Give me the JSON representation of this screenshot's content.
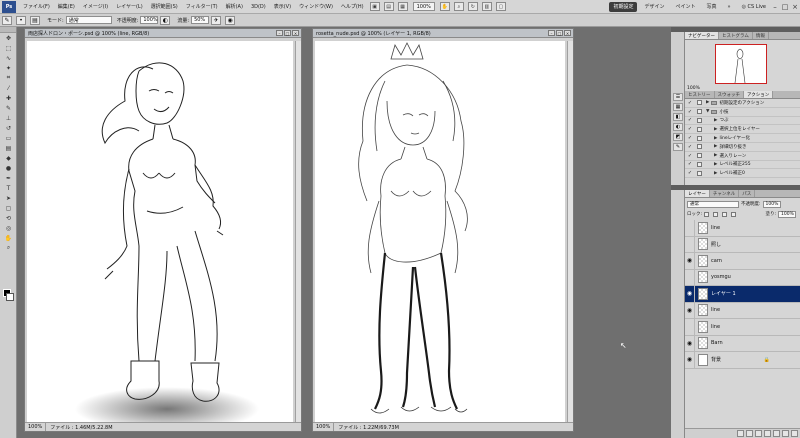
{
  "menubar": {
    "app_logo": "Ps",
    "items": [
      "ファイル(F)",
      "編集(E)",
      "イメージ(I)",
      "レイヤー(L)",
      "選択範囲(S)",
      "フィルター(T)",
      "解析(A)",
      "3D(D)",
      "表示(V)",
      "ウィンドウ(W)",
      "ヘルプ(H)"
    ],
    "zoom": "100%",
    "workspaces": [
      "初期設定",
      "デザイン",
      "ペイント",
      "写真"
    ],
    "active_workspace": "初期設定",
    "more": "»",
    "cslive": "CS Live",
    "window_controls": [
      "–",
      "□",
      "×"
    ]
  },
  "options": {
    "mode_label": "モード:",
    "mode_value": "通常",
    "opacity_label": "不透明度:",
    "opacity_value": "100%",
    "flow_label": "流量:",
    "flow_value": "50%"
  },
  "tools": {
    "icons": [
      "move-icon",
      "marquee-icon",
      "lasso-icon",
      "quick-select-icon",
      "crop-icon",
      "eyedropper-icon",
      "heal-icon",
      "brush-icon",
      "stamp-icon",
      "history-brush-icon",
      "eraser-icon",
      "gradient-icon",
      "blur-icon",
      "dodge-icon",
      "pen-icon",
      "type-icon",
      "path-select-icon",
      "shape-icon",
      "3d-rotate-icon",
      "3d-orbit-icon",
      "hand-icon",
      "zoom-icon"
    ],
    "foreground_color": "#000000",
    "background_color": "#ffffff"
  },
  "doc1": {
    "title": "両店探人ドロン・ポーシ.psd @ 100% (line, RGB/8)",
    "zoom": "100%",
    "file_size": "ファイル : 1.46M/5.22.8M"
  },
  "doc2": {
    "title": "rosetta_nude.psd @ 100% (レイヤー 1, RGB/8)",
    "zoom": "100%",
    "file_size": "ファイル : 1.22M/69.73M"
  },
  "navigator": {
    "tabs": [
      "ナビゲーター",
      "ヒストグラム",
      "情報"
    ],
    "zoom": "100%"
  },
  "actions": {
    "tabs": [
      "ヒストリー",
      "スウォッチ",
      "アクション"
    ],
    "rows": [
      {
        "label": "初期設定のアクション",
        "kind": "set"
      },
      {
        "label": "小技",
        "kind": "set"
      },
      {
        "label": "つぶ",
        "kind": "action"
      },
      {
        "label": "選択上位をレイヤー",
        "kind": "action"
      },
      {
        "label": "lineレイヤー化",
        "kind": "action"
      },
      {
        "label": "詳細切り抜き",
        "kind": "action"
      },
      {
        "label": "選入りレーン",
        "kind": "action"
      },
      {
        "label": "レベル補正255",
        "kind": "action"
      },
      {
        "label": "レベル補正0",
        "kind": "action"
      }
    ]
  },
  "layers": {
    "tabs": [
      "レイヤー",
      "チャンネル",
      "パス"
    ],
    "blend_mode": "通常",
    "opacity_label": "不透明度:",
    "opacity_value": "100%",
    "lock_label": "ロック:",
    "fill_label": "塗り:",
    "fill_value": "100%",
    "items": [
      {
        "name": "line",
        "visible": false,
        "selected": false
      },
      {
        "name": "照し",
        "visible": false,
        "selected": false
      },
      {
        "name": "carn",
        "visible": true,
        "selected": false
      },
      {
        "name": "yosmgu",
        "visible": false,
        "selected": false
      },
      {
        "name": "レイヤー 1",
        "visible": true,
        "selected": true
      },
      {
        "name": "line",
        "visible": true,
        "selected": false
      },
      {
        "name": "line",
        "visible": false,
        "selected": false
      },
      {
        "name": "Barn",
        "visible": true,
        "selected": false
      },
      {
        "name": "背景",
        "visible": true,
        "selected": false
      }
    ]
  }
}
